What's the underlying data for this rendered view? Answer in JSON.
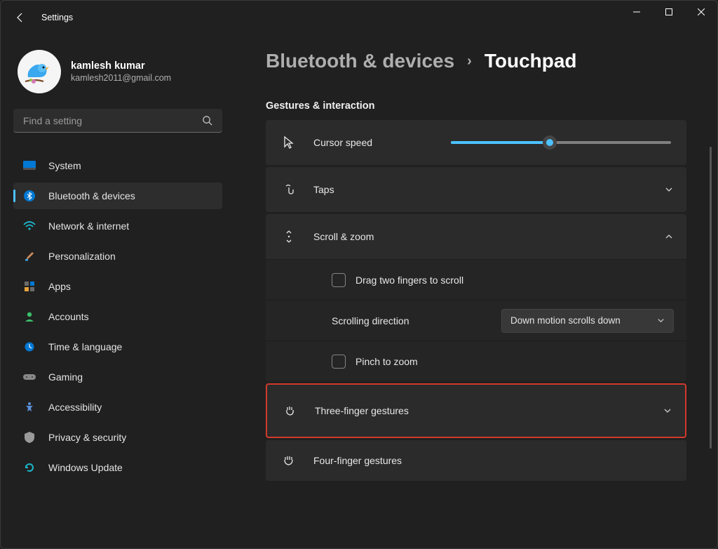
{
  "titlebar": {
    "app_title": "Settings"
  },
  "user": {
    "name": "kamlesh kumar",
    "email": "kamlesh2011@gmail.com"
  },
  "search": {
    "placeholder": "Find a setting"
  },
  "nav": {
    "items": [
      {
        "label": "System"
      },
      {
        "label": "Bluetooth & devices"
      },
      {
        "label": "Network & internet"
      },
      {
        "label": "Personalization"
      },
      {
        "label": "Apps"
      },
      {
        "label": "Accounts"
      },
      {
        "label": "Time & language"
      },
      {
        "label": "Gaming"
      },
      {
        "label": "Accessibility"
      },
      {
        "label": "Privacy & security"
      },
      {
        "label": "Windows Update"
      }
    ],
    "active_index": 1
  },
  "breadcrumb": {
    "parent": "Bluetooth & devices",
    "current": "Touchpad"
  },
  "section": {
    "title": "Gestures & interaction"
  },
  "rows": {
    "cursor_speed": {
      "label": "Cursor speed"
    },
    "taps": {
      "label": "Taps"
    },
    "scroll_zoom": {
      "label": "Scroll & zoom",
      "drag_two": "Drag two fingers to scroll",
      "direction_label": "Scrolling direction",
      "direction_value": "Down motion scrolls down",
      "pinch": "Pinch to zoom"
    },
    "three_finger": {
      "label": "Three-finger gestures"
    },
    "four_finger": {
      "label": "Four-finger gestures"
    }
  },
  "slider": {
    "percent": 45
  }
}
